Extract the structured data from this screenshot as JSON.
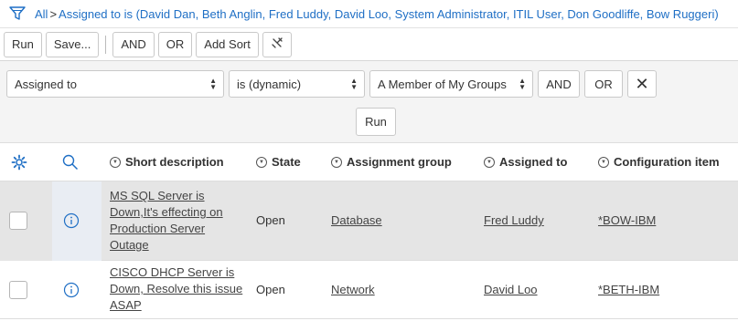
{
  "breadcrumb": {
    "root": "All",
    "separator": ">",
    "condition": "Assigned to is (David Dan, Beth Anglin, Fred Luddy, David Loo, System Administrator, ITIL User, Don Goodliffe, Bow Ruggeri)"
  },
  "toolbar": {
    "run": "Run",
    "save": "Save...",
    "and": "AND",
    "or": "OR",
    "add_sort": "Add Sort"
  },
  "condition": {
    "field": "Assigned to",
    "operator": "is (dynamic)",
    "value": "A Member of My Groups",
    "and": "AND",
    "or": "OR",
    "close": "✕",
    "run": "Run"
  },
  "table": {
    "columns": {
      "short_description": "Short description",
      "state": "State",
      "assignment_group": "Assignment group",
      "assigned_to": "Assigned to",
      "configuration_item": "Configuration item"
    },
    "rows": [
      {
        "short_description": "MS SQL Server is Down,It's effecting on Production Server Outage",
        "state": "Open",
        "assignment_group": "Database",
        "assigned_to": "Fred Luddy",
        "configuration_item": "*BOW-IBM"
      },
      {
        "short_description": "CISCO DHCP Server is Down, Resolve this issue ASAP",
        "state": "Open",
        "assignment_group": "Network",
        "assigned_to": "David Loo",
        "configuration_item": "*BETH-IBM"
      }
    ]
  },
  "colors": {
    "link_blue": "#1f6fc5",
    "selected_row": "#e5e5e5",
    "condition_bg": "#f4f4f4"
  },
  "icons": [
    "filter-icon",
    "wrench-icon",
    "close-icon",
    "gear-icon",
    "search-icon",
    "sort-icon",
    "info-icon"
  ]
}
